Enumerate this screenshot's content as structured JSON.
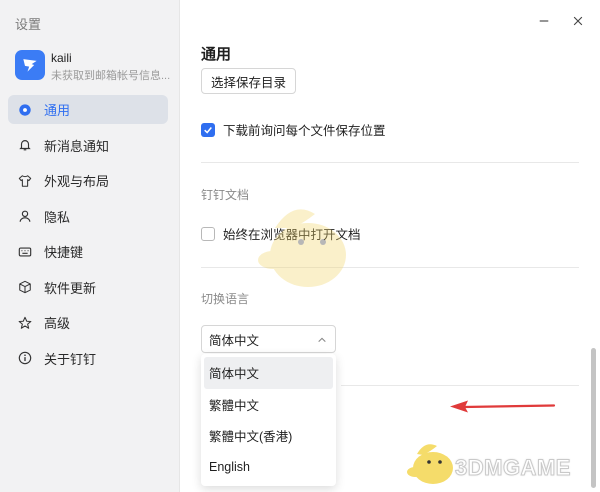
{
  "window": {
    "title": "设置",
    "minimize_icon": "minus",
    "close_icon": "x"
  },
  "profile": {
    "name": "kaili",
    "subtitle": "未获取到邮箱帐号信息..."
  },
  "nav": {
    "items": [
      {
        "label": "通用",
        "icon": "gear-icon",
        "active": true
      },
      {
        "label": "新消息通知",
        "icon": "bell-icon"
      },
      {
        "label": "外观与布局",
        "icon": "shirt-icon"
      },
      {
        "label": "隐私",
        "icon": "person-icon"
      },
      {
        "label": "快捷键",
        "icon": "keyboard-icon"
      },
      {
        "label": "软件更新",
        "icon": "cube-icon"
      },
      {
        "label": "高级",
        "icon": "star-icon"
      },
      {
        "label": "关于钉钉",
        "icon": "info-icon"
      }
    ]
  },
  "general": {
    "title": "通用",
    "select_folder_button": "选择保存目录",
    "ask_each_download": {
      "label": "下载前询问每个文件保存位置",
      "checked": true
    }
  },
  "dingdoc": {
    "label": "钉钉文档",
    "open_in_browser": {
      "label": "始终在浏览器中打开文档",
      "checked": false
    }
  },
  "language": {
    "label": "切换语言",
    "selected": "简体中文",
    "options": [
      "简体中文",
      "繁體中文",
      "繁體中文(香港)",
      "English"
    ]
  },
  "watermark": {
    "text": "3DMGAME"
  },
  "colors": {
    "accent": "#2f6ef0",
    "arrow": "#e03a3a"
  }
}
